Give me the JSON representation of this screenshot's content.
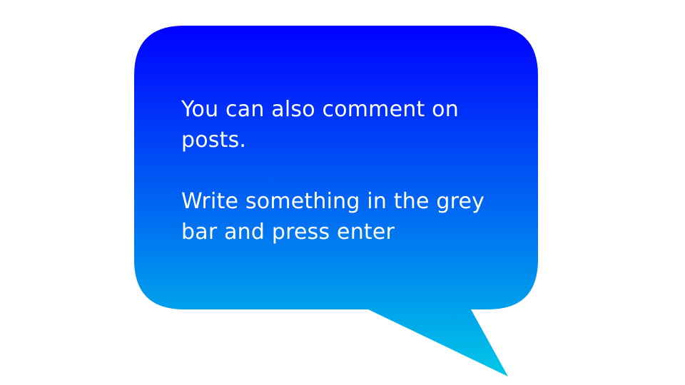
{
  "tooltip": {
    "paragraphs": [
      "You can also comment on posts.",
      "Write something in the grey bar and press enter"
    ],
    "colors": {
      "gradient_top": "#0000ff",
      "gradient_bottom": "#00c8e6",
      "text": "#ffffff",
      "background": "#ffffff"
    }
  }
}
